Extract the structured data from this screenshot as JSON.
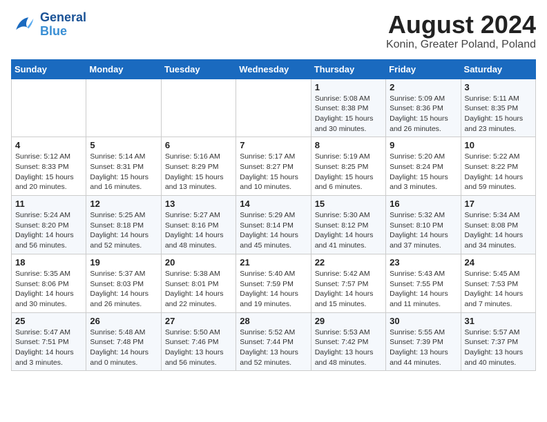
{
  "header": {
    "logo_text_general": "General",
    "logo_text_blue": "Blue",
    "title": "August 2024",
    "subtitle": "Konin, Greater Poland, Poland"
  },
  "calendar": {
    "weekdays": [
      "Sunday",
      "Monday",
      "Tuesday",
      "Wednesday",
      "Thursday",
      "Friday",
      "Saturday"
    ],
    "weeks": [
      [
        {
          "day": "",
          "info": ""
        },
        {
          "day": "",
          "info": ""
        },
        {
          "day": "",
          "info": ""
        },
        {
          "day": "",
          "info": ""
        },
        {
          "day": "1",
          "info": "Sunrise: 5:08 AM\nSunset: 8:38 PM\nDaylight: 15 hours\nand 30 minutes."
        },
        {
          "day": "2",
          "info": "Sunrise: 5:09 AM\nSunset: 8:36 PM\nDaylight: 15 hours\nand 26 minutes."
        },
        {
          "day": "3",
          "info": "Sunrise: 5:11 AM\nSunset: 8:35 PM\nDaylight: 15 hours\nand 23 minutes."
        }
      ],
      [
        {
          "day": "4",
          "info": "Sunrise: 5:12 AM\nSunset: 8:33 PM\nDaylight: 15 hours\nand 20 minutes."
        },
        {
          "day": "5",
          "info": "Sunrise: 5:14 AM\nSunset: 8:31 PM\nDaylight: 15 hours\nand 16 minutes."
        },
        {
          "day": "6",
          "info": "Sunrise: 5:16 AM\nSunset: 8:29 PM\nDaylight: 15 hours\nand 13 minutes."
        },
        {
          "day": "7",
          "info": "Sunrise: 5:17 AM\nSunset: 8:27 PM\nDaylight: 15 hours\nand 10 minutes."
        },
        {
          "day": "8",
          "info": "Sunrise: 5:19 AM\nSunset: 8:25 PM\nDaylight: 15 hours\nand 6 minutes."
        },
        {
          "day": "9",
          "info": "Sunrise: 5:20 AM\nSunset: 8:24 PM\nDaylight: 15 hours\nand 3 minutes."
        },
        {
          "day": "10",
          "info": "Sunrise: 5:22 AM\nSunset: 8:22 PM\nDaylight: 14 hours\nand 59 minutes."
        }
      ],
      [
        {
          "day": "11",
          "info": "Sunrise: 5:24 AM\nSunset: 8:20 PM\nDaylight: 14 hours\nand 56 minutes."
        },
        {
          "day": "12",
          "info": "Sunrise: 5:25 AM\nSunset: 8:18 PM\nDaylight: 14 hours\nand 52 minutes."
        },
        {
          "day": "13",
          "info": "Sunrise: 5:27 AM\nSunset: 8:16 PM\nDaylight: 14 hours\nand 48 minutes."
        },
        {
          "day": "14",
          "info": "Sunrise: 5:29 AM\nSunset: 8:14 PM\nDaylight: 14 hours\nand 45 minutes."
        },
        {
          "day": "15",
          "info": "Sunrise: 5:30 AM\nSunset: 8:12 PM\nDaylight: 14 hours\nand 41 minutes."
        },
        {
          "day": "16",
          "info": "Sunrise: 5:32 AM\nSunset: 8:10 PM\nDaylight: 14 hours\nand 37 minutes."
        },
        {
          "day": "17",
          "info": "Sunrise: 5:34 AM\nSunset: 8:08 PM\nDaylight: 14 hours\nand 34 minutes."
        }
      ],
      [
        {
          "day": "18",
          "info": "Sunrise: 5:35 AM\nSunset: 8:06 PM\nDaylight: 14 hours\nand 30 minutes."
        },
        {
          "day": "19",
          "info": "Sunrise: 5:37 AM\nSunset: 8:03 PM\nDaylight: 14 hours\nand 26 minutes."
        },
        {
          "day": "20",
          "info": "Sunrise: 5:38 AM\nSunset: 8:01 PM\nDaylight: 14 hours\nand 22 minutes."
        },
        {
          "day": "21",
          "info": "Sunrise: 5:40 AM\nSunset: 7:59 PM\nDaylight: 14 hours\nand 19 minutes."
        },
        {
          "day": "22",
          "info": "Sunrise: 5:42 AM\nSunset: 7:57 PM\nDaylight: 14 hours\nand 15 minutes."
        },
        {
          "day": "23",
          "info": "Sunrise: 5:43 AM\nSunset: 7:55 PM\nDaylight: 14 hours\nand 11 minutes."
        },
        {
          "day": "24",
          "info": "Sunrise: 5:45 AM\nSunset: 7:53 PM\nDaylight: 14 hours\nand 7 minutes."
        }
      ],
      [
        {
          "day": "25",
          "info": "Sunrise: 5:47 AM\nSunset: 7:51 PM\nDaylight: 14 hours\nand 3 minutes."
        },
        {
          "day": "26",
          "info": "Sunrise: 5:48 AM\nSunset: 7:48 PM\nDaylight: 14 hours\nand 0 minutes."
        },
        {
          "day": "27",
          "info": "Sunrise: 5:50 AM\nSunset: 7:46 PM\nDaylight: 13 hours\nand 56 minutes."
        },
        {
          "day": "28",
          "info": "Sunrise: 5:52 AM\nSunset: 7:44 PM\nDaylight: 13 hours\nand 52 minutes."
        },
        {
          "day": "29",
          "info": "Sunrise: 5:53 AM\nSunset: 7:42 PM\nDaylight: 13 hours\nand 48 minutes."
        },
        {
          "day": "30",
          "info": "Sunrise: 5:55 AM\nSunset: 7:39 PM\nDaylight: 13 hours\nand 44 minutes."
        },
        {
          "day": "31",
          "info": "Sunrise: 5:57 AM\nSunset: 7:37 PM\nDaylight: 13 hours\nand 40 minutes."
        }
      ]
    ]
  }
}
